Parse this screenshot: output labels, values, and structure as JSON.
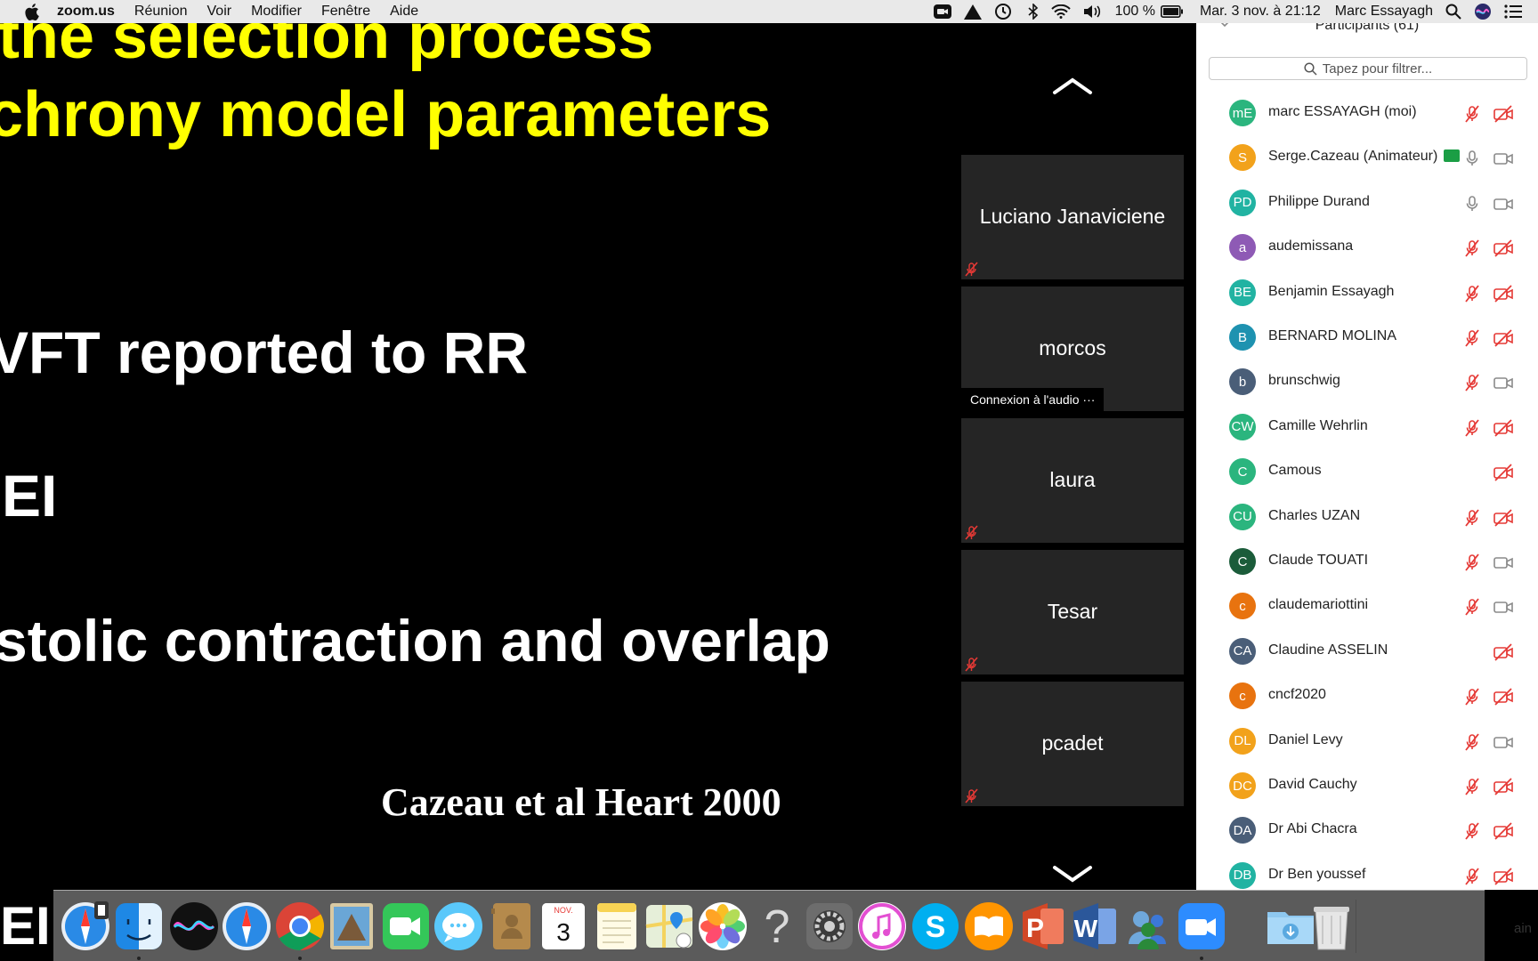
{
  "menubar": {
    "app": "zoom.us",
    "items": [
      "Réunion",
      "Voir",
      "Modifier",
      "Fenêtre",
      "Aide"
    ],
    "battery": "100 %",
    "datetime": "Mar. 3 nov. à  21:12",
    "user": "Marc Essayagh"
  },
  "slide": {
    "line1": "the selection process",
    "line2": "chrony model parameters",
    "line3": "VFT reported to RR",
    "line4": "EI",
    "line5": "stolic contraction and overlap",
    "citation": "Cazeau et al Heart 2000",
    "bottom_fragment": "EI"
  },
  "videos": [
    {
      "name": "Luciano Janaviciene",
      "muted": true
    },
    {
      "name": "morcos",
      "status": "Connexion à l'audio ···"
    },
    {
      "name": "laura",
      "muted": true
    },
    {
      "name": "Tesar",
      "muted": true
    },
    {
      "name": "pcadet",
      "muted": true
    }
  ],
  "participants_panel": {
    "title": "Participants (61)",
    "search_placeholder": "Tapez pour filtrer...",
    "items": [
      {
        "initials": "mE",
        "name": "marc ESSAYAGH (moi)",
        "color": "#2bb57e",
        "mic": "off",
        "cam": "off"
      },
      {
        "initials": "S",
        "name": "Serge.Cazeau  (Animateur)",
        "color": "#f2a21b",
        "mic": "on",
        "cam": "on",
        "sharing": true
      },
      {
        "initials": "PD",
        "name": "Philippe Durand",
        "color": "#21b3a2",
        "mic": "on",
        "cam": "on"
      },
      {
        "initials": "a",
        "name": "audemissana",
        "color": "#8e5ab5",
        "mic": "off",
        "cam": "off"
      },
      {
        "initials": "BE",
        "name": "Benjamin Essayagh",
        "color": "#21b3a2",
        "mic": "off",
        "cam": "off"
      },
      {
        "initials": "B",
        "name": "BERNARD MOLINA",
        "color": "#1e92b0",
        "mic": "off",
        "cam": "off"
      },
      {
        "initials": "b",
        "name": "brunschwig",
        "color": "#4a5e78",
        "mic": "off",
        "cam": "on"
      },
      {
        "initials": "CW",
        "name": "Camille Wehrlin",
        "color": "#2bb57e",
        "mic": "off",
        "cam": "off"
      },
      {
        "initials": "C",
        "name": "Camous",
        "color": "#2bb57e",
        "mic": "none",
        "cam": "off"
      },
      {
        "initials": "CU",
        "name": "Charles UZAN",
        "color": "#2bb57e",
        "mic": "off",
        "cam": "off"
      },
      {
        "initials": "C",
        "name": "Claude TOUATI",
        "color": "#1b5c3a",
        "mic": "off",
        "cam": "on"
      },
      {
        "initials": "c",
        "name": "claudemariottini",
        "color": "#e8730f",
        "mic": "off",
        "cam": "on"
      },
      {
        "initials": "CA",
        "name": "Claudine ASSELIN",
        "color": "#4a5e78",
        "mic": "none",
        "cam": "off"
      },
      {
        "initials": "c",
        "name": "cncf2020",
        "color": "#e8730f",
        "mic": "off",
        "cam": "off"
      },
      {
        "initials": "DL",
        "name": "Daniel Levy",
        "color": "#f2a21b",
        "mic": "off",
        "cam": "on"
      },
      {
        "initials": "DC",
        "name": "David Cauchy",
        "color": "#f2a21b",
        "mic": "off",
        "cam": "off"
      },
      {
        "initials": "DA",
        "name": "Dr Abi Chacra",
        "color": "#4a5e78",
        "mic": "off",
        "cam": "off"
      },
      {
        "initials": "DB",
        "name": "Dr Ben youssef",
        "color": "#21b3a2",
        "mic": "off",
        "cam": "off"
      }
    ]
  },
  "dock": {
    "items": [
      "safari-screen-icon",
      "finder-icon",
      "siri-icon",
      "safari-icon",
      "chrome-icon",
      "mail-icon",
      "facetime-icon",
      "messages-icon",
      "contacts-icon",
      "calendar-icon",
      "notes-icon",
      "maps-icon",
      "photos-icon",
      "unknown-app-icon",
      "system-preferences-icon",
      "itunes-icon",
      "skype-icon",
      "books-icon",
      "powerpoint-icon",
      "word-icon",
      "teams-icon",
      "zoom-icon",
      "downloads-folder-icon",
      "trash-icon"
    ],
    "calendar_month": "NOV.",
    "calendar_day": "3",
    "edge_label": "ain"
  }
}
